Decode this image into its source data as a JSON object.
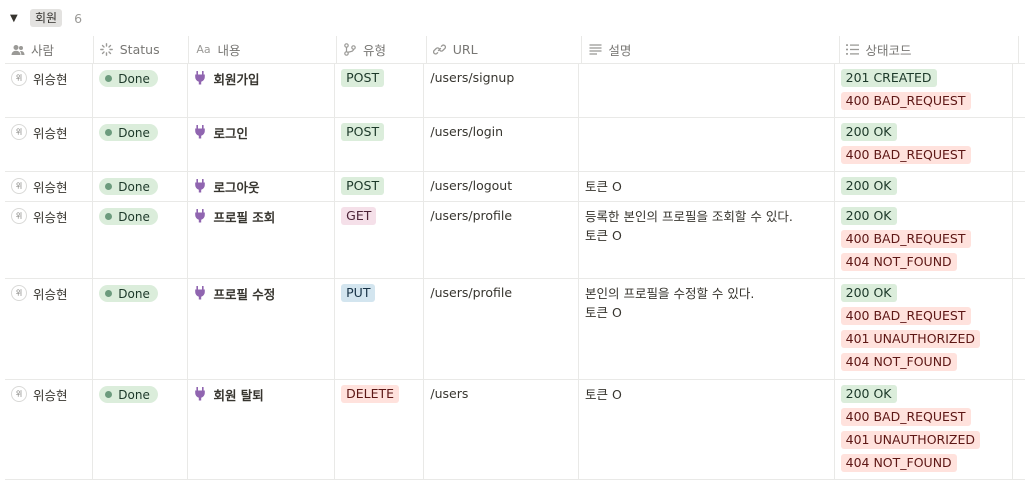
{
  "group": {
    "toggle": "▼",
    "label": "회원",
    "count": "6"
  },
  "columns": {
    "person": "사람",
    "status": "Status",
    "name": "내용",
    "type": "유형",
    "url": "URL",
    "desc": "설명",
    "code": "상태코드"
  },
  "colors": {
    "done_bg": "#dbeddb",
    "done_dot": "#6c9b7d",
    "green_bg": "#dbeddb",
    "green_fg": "#1c3829",
    "pink_bg": "#f5e0e9",
    "pink_fg": "#4c2337",
    "blue_bg": "#d3e5ef",
    "blue_fg": "#183347",
    "red_bg": "#ffe2dd",
    "red_fg": "#5d1715",
    "plug": "#9065b0"
  },
  "rows": [
    {
      "avatar": "위",
      "person": "위승현",
      "status": "Done",
      "name": "회원가입",
      "type": "POST",
      "type_color": "green",
      "url": "/users/signup",
      "desc": [],
      "codes": [
        {
          "text": "201 CREATED",
          "color": "green"
        },
        {
          "text": "400 BAD_REQUEST",
          "color": "red"
        }
      ]
    },
    {
      "avatar": "위",
      "person": "위승현",
      "status": "Done",
      "name": "로그인",
      "type": "POST",
      "type_color": "green",
      "url": "/users/login",
      "desc": [],
      "codes": [
        {
          "text": "200 OK",
          "color": "green"
        },
        {
          "text": "400 BAD_REQUEST",
          "color": "red"
        }
      ]
    },
    {
      "avatar": "위",
      "person": "위승현",
      "status": "Done",
      "name": "로그아웃",
      "type": "POST",
      "type_color": "green",
      "url": "/users/logout",
      "desc": [
        "토큰 O"
      ],
      "codes": [
        {
          "text": "200 OK",
          "color": "green"
        }
      ]
    },
    {
      "avatar": "위",
      "person": "위승현",
      "status": "Done",
      "name": "프로필 조회",
      "type": "GET",
      "type_color": "pink",
      "url": "/users/profile",
      "desc": [
        "등록한 본인의 프로필을 조회할 수 있다.",
        "토큰 O"
      ],
      "codes": [
        {
          "text": "200 OK",
          "color": "green"
        },
        {
          "text": "400 BAD_REQUEST",
          "color": "red"
        },
        {
          "text": "404 NOT_FOUND",
          "color": "red"
        }
      ]
    },
    {
      "avatar": "위",
      "person": "위승현",
      "status": "Done",
      "name": "프로필 수정",
      "type": "PUT",
      "type_color": "blue",
      "url": "/users/profile",
      "desc": [
        "본인의 프로필을 수정할 수 있다.",
        "토큰 O"
      ],
      "codes": [
        {
          "text": "200 OK",
          "color": "green"
        },
        {
          "text": "400 BAD_REQUEST",
          "color": "red"
        },
        {
          "text": "401 UNAUTHORIZED",
          "color": "red"
        },
        {
          "text": "404 NOT_FOUND",
          "color": "red"
        }
      ]
    },
    {
      "avatar": "위",
      "person": "위승현",
      "status": "Done",
      "name": "회원 탈퇴",
      "type": "DELETE",
      "type_color": "red",
      "url": "/users",
      "desc": [
        "토큰 O"
      ],
      "codes": [
        {
          "text": "200 OK",
          "color": "green"
        },
        {
          "text": "400 BAD_REQUEST",
          "color": "red"
        },
        {
          "text": "401 UNAUTHORIZED",
          "color": "red"
        },
        {
          "text": "404 NOT_FOUND",
          "color": "red"
        }
      ]
    }
  ]
}
